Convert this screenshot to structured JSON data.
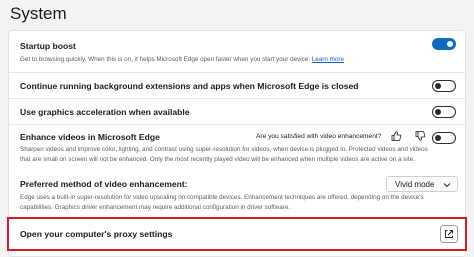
{
  "page": {
    "title": "System"
  },
  "settings": {
    "startup_boost": {
      "title": "Startup boost",
      "description": "Get to browsing quickly. When this is on, it helps Microsoft Edge open faster when you start your device.",
      "link": "Learn more",
      "toggle_on": true
    },
    "background_apps": {
      "title": "Continue running background extensions and apps when Microsoft Edge is closed",
      "toggle_on": false
    },
    "graphics_acceleration": {
      "title": "Use graphics acceleration when available",
      "toggle_on": false
    },
    "enhance_videos": {
      "title": "Enhance videos in Microsoft Edge",
      "feedback_question": "Are you satisfied with video enhancement?",
      "description_lines": [
        "Sharpen videos and improve color, lighting, and contrast using super-resolution for videos, when device is plugged in. Protected videos and videos",
        "that are small on screen will not be enhanced. Only the most recently played video will be enhanced when multiple videos are active on a site."
      ],
      "toggle_on": false
    },
    "enhancement_method": {
      "title": "Preferred method of video enhancement:",
      "selected": "Vivid mode",
      "description_lines": [
        "Edge uses a built-in super-resolution for video upscaling on compatible devices. Enhancement techniques are offered, depending on the device's",
        "capabilities. Graphics driver enhancement may require additional configuration in driver software."
      ]
    },
    "proxy": {
      "title": "Open your computer's proxy settings"
    }
  },
  "colors": {
    "accent": "#0f6cbd",
    "highlight": "#d71a28"
  }
}
